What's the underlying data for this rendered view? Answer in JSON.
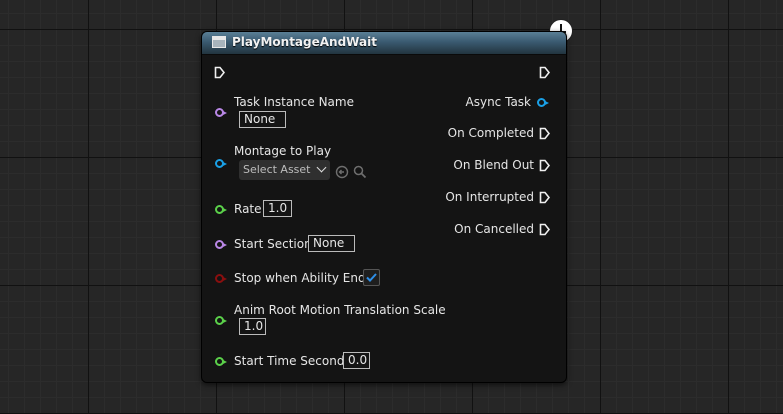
{
  "node": {
    "title": "PlayMontageAndWait"
  },
  "inputs": {
    "task_instance_name": {
      "label": "Task Instance Name",
      "value": "None"
    },
    "montage_to_play": {
      "label": "Montage to Play",
      "value": "Select Asset"
    },
    "rate": {
      "label": "Rate",
      "value": "1.0"
    },
    "start_section": {
      "label": "Start Section",
      "value": "None"
    },
    "stop_when_ability_ends": {
      "label": "Stop when Ability Ends",
      "checked": true
    },
    "anim_root_motion_translation_scale": {
      "label": "Anim Root Motion Translation Scale",
      "value": "1.0"
    },
    "start_time_seconds": {
      "label": "Start Time Seconds",
      "value": "0.0"
    }
  },
  "outputs": {
    "async_task": "Async Task",
    "on_completed": "On Completed",
    "on_blend_out": "On Blend Out",
    "on_interrupted": "On Interrupted",
    "on_cancelled": "On Cancelled"
  },
  "colors": {
    "object_pin": "#b987e6",
    "asset_pin": "#1aa0e6",
    "float_pin": "#5bd14a",
    "bool_pin": "#8a0f0f",
    "header": "#3a5a70"
  },
  "icons": [
    "latent-clock-icon",
    "function-node-icon",
    "exec-pin-icon",
    "combo-chevron-icon",
    "use-selected-asset-icon",
    "browse-asset-icon",
    "checkmark-icon"
  ]
}
